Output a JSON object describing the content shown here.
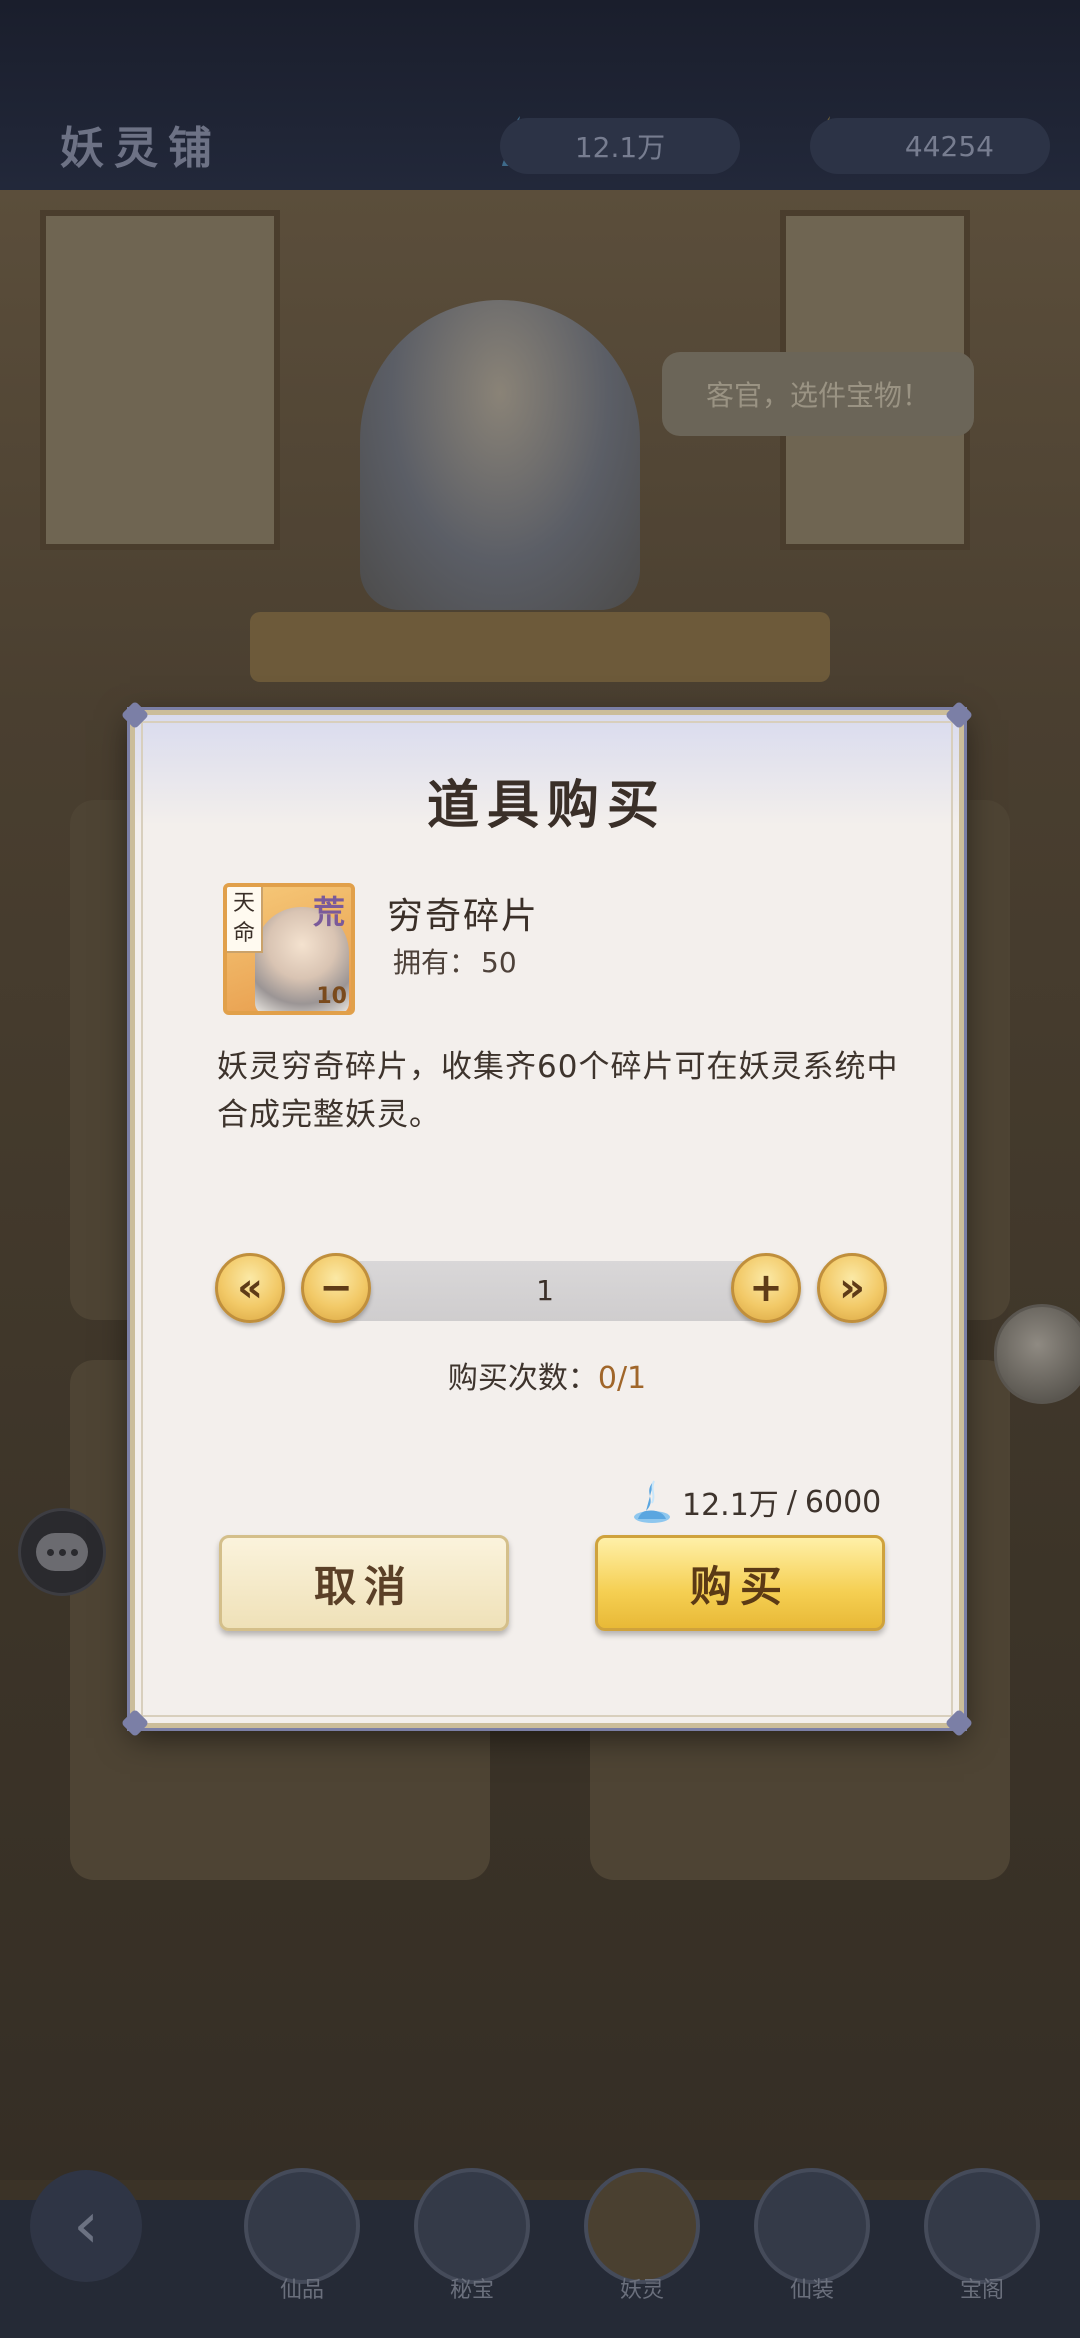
{
  "background": {
    "header_title": "妖灵铺",
    "resources": {
      "spirit_amount": "12.1万",
      "energy_amount": "44254"
    },
    "speech_bubble": "客官，选件宝物！",
    "nav": [
      "仙品",
      "秘宝",
      "妖灵",
      "仙装",
      "宝阁"
    ]
  },
  "dialog": {
    "title": "道具购买",
    "item": {
      "name": "穷奇碎片",
      "owned_label": "拥有：",
      "owned_value": "50",
      "tag": "天命",
      "rank": "荒",
      "level": "10"
    },
    "description": "妖灵穷奇碎片，收集齐60个碎片可在妖灵系统中合成完整妖灵。",
    "quantity": {
      "value": "1",
      "first_label": "«",
      "minus_label": "−",
      "plus_label": "+",
      "last_label": "»"
    },
    "purchase_count": {
      "label": "购买次数：",
      "value": "0/1"
    },
    "cost": {
      "owned": "12.1万",
      "separator": "/",
      "price": "6000"
    },
    "buttons": {
      "cancel": "取消",
      "buy": "购买"
    }
  },
  "icons": {
    "cost_icon": "blue-spirit-icon",
    "chat_icon": "chat-icon",
    "back_icon": "back-arrow-icon"
  }
}
